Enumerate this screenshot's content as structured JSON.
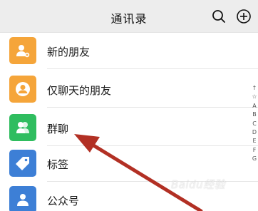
{
  "header": {
    "title": "通讯录"
  },
  "list": {
    "items": [
      {
        "label": "新的朋友",
        "icon": "add-friend-icon",
        "color": "#f5a53a"
      },
      {
        "label": "仅聊天的朋友",
        "icon": "chat-only-friend-icon",
        "color": "#f5a53a"
      },
      {
        "label": "群聊",
        "icon": "group-chat-icon",
        "color": "#2fbd5f"
      },
      {
        "label": "标签",
        "icon": "tag-icon",
        "color": "#3d7fd6"
      },
      {
        "label": "公众号",
        "icon": "official-account-icon",
        "color": "#3d7fd6"
      }
    ]
  },
  "index_bar": [
    "↑",
    "☆",
    "A",
    "B",
    "C",
    "D",
    "E",
    "F",
    "G"
  ],
  "watermark": "Baidu经验",
  "colors": {
    "arrow": "#b23024",
    "background": "#ededed"
  }
}
